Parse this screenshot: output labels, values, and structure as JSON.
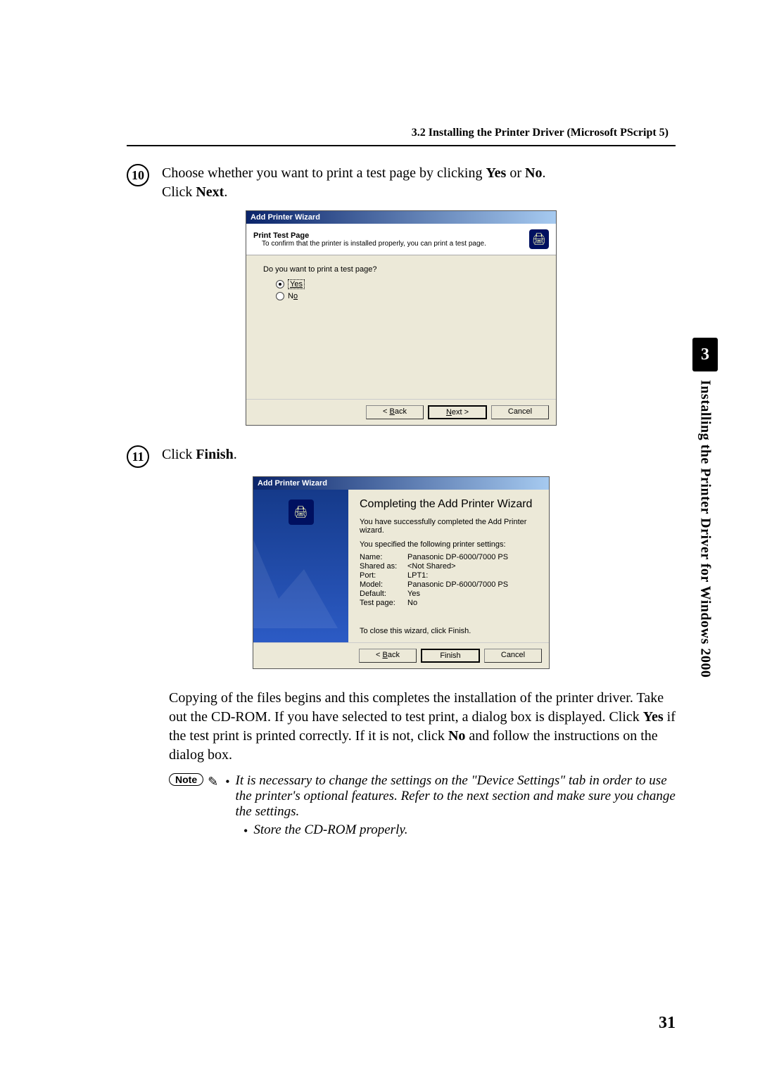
{
  "section_header": "3.2   Installing the Printer Driver (Microsoft PScript 5)",
  "step10_num": "⑩",
  "step10_text_pre": "Choose whether you want to print a test page by clicking ",
  "step10_bold1": "Yes",
  "step10_or": " or ",
  "step10_bold2": "No",
  "step10_after": ".",
  "step10_line2_pre": "Click ",
  "step10_line2_bold": "Next",
  "step10_line2_after": ".",
  "dlg1": {
    "title": "Add Printer Wizard",
    "header_title": "Print Test Page",
    "header_sub": "To confirm that the printer is installed properly, you can print a test page.",
    "question": "Do you want to print a test page?",
    "opt_yes": "Yes",
    "opt_no": "No",
    "back": "< Back",
    "next": "Next >",
    "cancel": "Cancel"
  },
  "step11_num": "⑪",
  "step11_pre": "Click ",
  "step11_bold": "Finish",
  "step11_after": ".",
  "dlg2": {
    "title": "Add Printer Wizard",
    "heading": "Completing the Add Printer Wizard",
    "msg1": "You have successfully completed the Add Printer wizard.",
    "msg2": "You specified the following printer settings:",
    "rows": {
      "name_k": "Name:",
      "name_v": "Panasonic DP-6000/7000 PS",
      "shared_k": "Shared as:",
      "shared_v": "<Not Shared>",
      "port_k": "Port:",
      "port_v": "LPT1:",
      "model_k": "Model:",
      "model_v": "Panasonic DP-6000/7000 PS",
      "default_k": "Default:",
      "default_v": "Yes",
      "test_k": "Test page:",
      "test_v": "No"
    },
    "close_msg": "To close this wizard, click Finish.",
    "back": "< Back",
    "finish": "Finish",
    "cancel": "Cancel"
  },
  "body1_pre": "Copying of the files begins and this completes the installation of the printer driver. Take out the CD-ROM. If you have selected to test print, a dialog box is displayed. Click ",
  "body1_b1": "Yes",
  "body1_mid": " if the test print is printed correctly. If it is not, click ",
  "body1_b2": "No",
  "body1_post": " and follow the instructions on the dialog box.",
  "note_label": "Note",
  "note1": "It is necessary to change the settings on the \"Device Settings\" tab in order to use the printer's optional features. Refer to the next section and make sure you change the settings.",
  "note2": "Store the CD-ROM properly.",
  "side_chapter": "3",
  "side_text": "Installing the Printer Driver for Windows 2000",
  "page_number": "31"
}
